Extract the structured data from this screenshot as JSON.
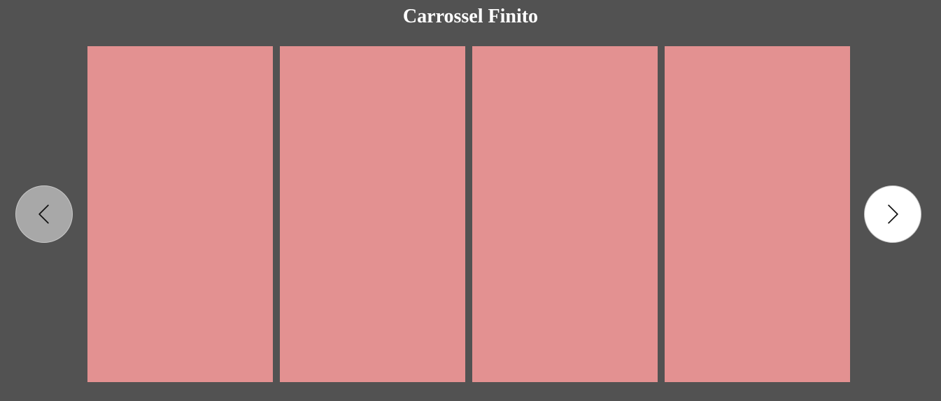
{
  "page": {
    "title": "Carrossel Finito",
    "background_color": "#525252"
  },
  "carousel": {
    "slide_color": "#e39191",
    "slides": [
      {
        "id": 1
      },
      {
        "id": 2
      },
      {
        "id": 3
      },
      {
        "id": 4
      }
    ],
    "prev_button": {
      "icon": "chevron-left-icon",
      "state": "disabled",
      "background": "#a8a8a8"
    },
    "next_button": {
      "icon": "chevron-right-icon",
      "state": "enabled",
      "background": "#ffffff"
    }
  }
}
